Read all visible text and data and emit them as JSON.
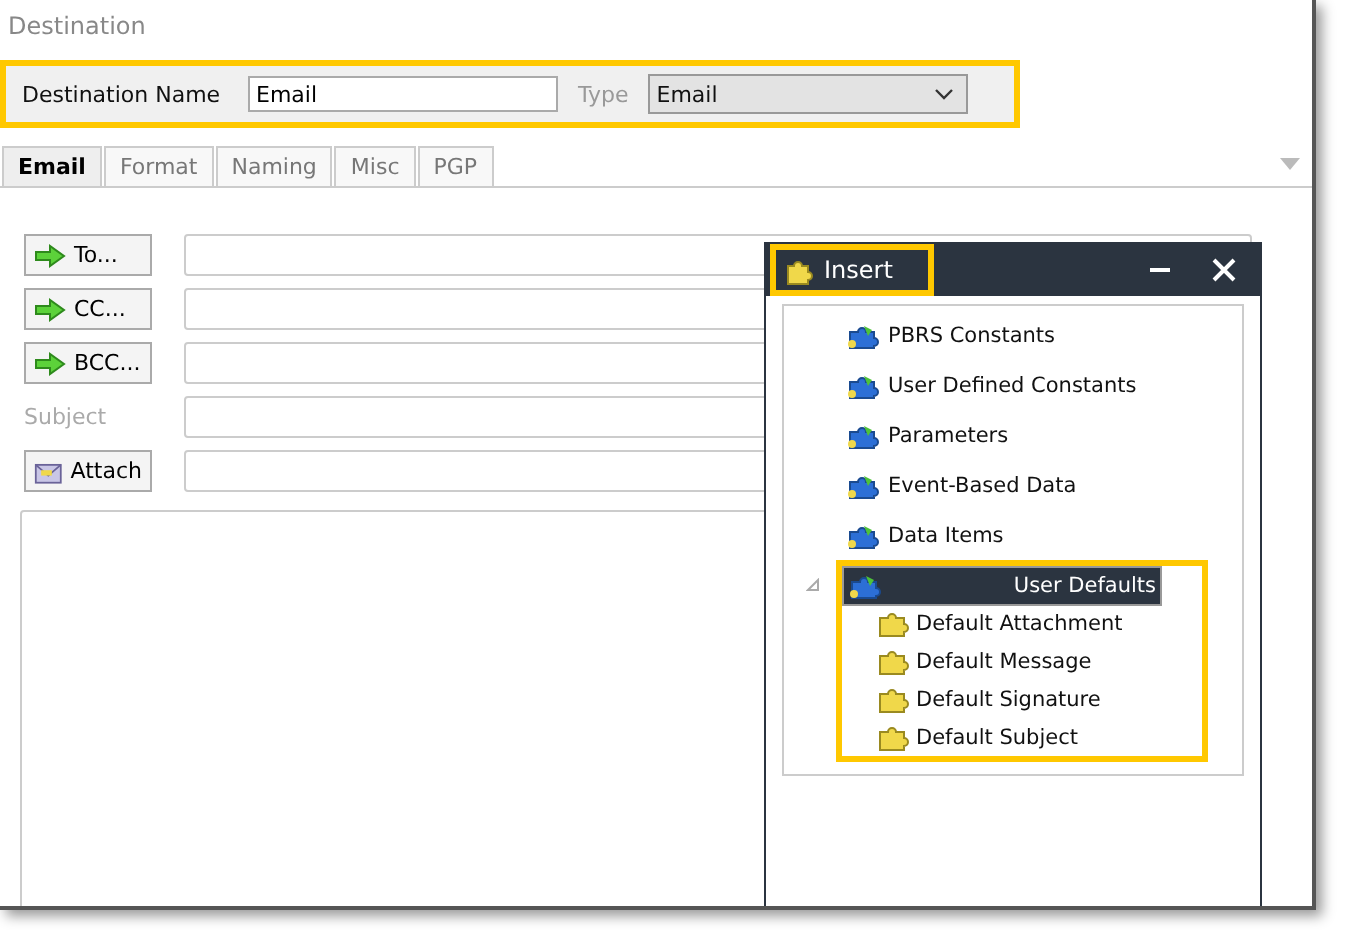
{
  "window": {
    "title": "Destination"
  },
  "header": {
    "highlighted": true,
    "name_label": "Destination Name",
    "name_value": "Email",
    "type_label": "Type",
    "type_value": "Email"
  },
  "tabs": [
    {
      "label": "Email",
      "selected": true
    },
    {
      "label": "Format",
      "selected": false
    },
    {
      "label": "Naming",
      "selected": false
    },
    {
      "label": "Misc",
      "selected": false
    },
    {
      "label": "PGP",
      "selected": false
    }
  ],
  "address_rows": [
    {
      "kind": "arrow",
      "label": "To..."
    },
    {
      "kind": "arrow",
      "label": "CC..."
    },
    {
      "kind": "arrow",
      "label": "BCC..."
    },
    {
      "kind": "label",
      "label": "Subject"
    },
    {
      "kind": "attach",
      "label": "Attach"
    }
  ],
  "insert_panel": {
    "title": "Insert",
    "title_highlighted": true,
    "items": [
      {
        "label": "PBRS Constants",
        "selected": false,
        "highlighted": false
      },
      {
        "label": "User Defined Constants",
        "selected": false,
        "highlighted": false
      },
      {
        "label": "Parameters",
        "selected": false,
        "highlighted": false
      },
      {
        "label": "Event-Based Data",
        "selected": false,
        "highlighted": false
      },
      {
        "label": "Data Items",
        "selected": false,
        "highlighted": false
      },
      {
        "label": "User Defaults",
        "selected": true,
        "highlighted": true,
        "expanded": true,
        "children": [
          {
            "label": "Default Attachment"
          },
          {
            "label": "Default Message"
          },
          {
            "label": "Default Signature"
          },
          {
            "label": "Default Subject"
          }
        ]
      }
    ]
  }
}
